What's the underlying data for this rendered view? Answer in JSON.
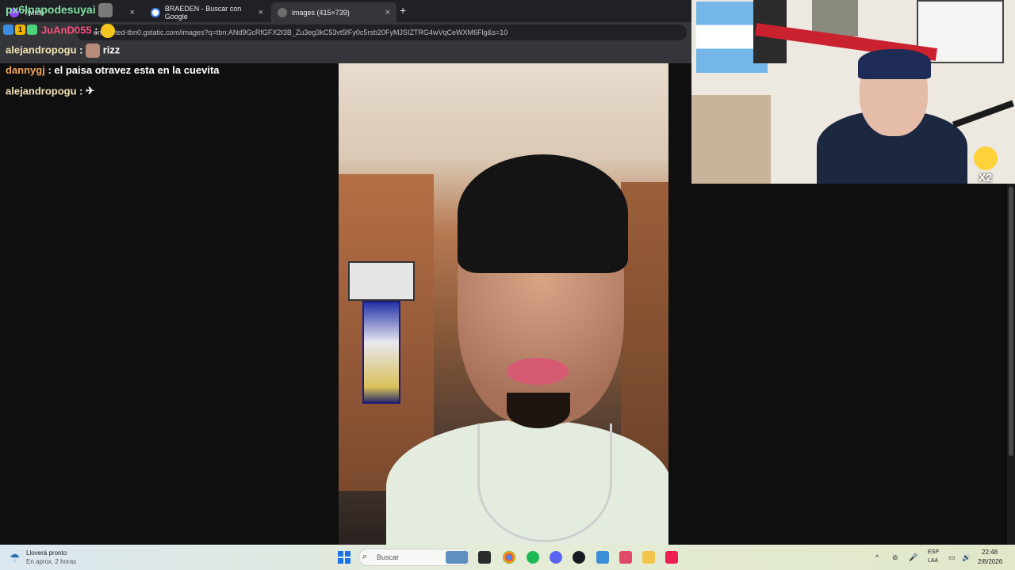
{
  "browser": {
    "tabs": [
      {
        "title": "Twitch",
        "active": false
      },
      {
        "title": "BRAEDEN - Buscar con Google",
        "active": false
      },
      {
        "title": "images (415×739)",
        "active": true
      }
    ],
    "url": "encrypted-tbn0.gstatic.com/images?q=tbn:ANd9GcRfGFX2I3B_Zu3eg3kC53vt5fFy0c5rsb20FyMJSIZTRG4wVqCeWXM6Flg&s=10",
    "close_glyph": "×",
    "new_tab_glyph": "+"
  },
  "chat": {
    "messages": [
      {
        "user": "px6lpapodesuyai",
        "message": ""
      },
      {
        "user": "JuAnD055",
        "message": ""
      },
      {
        "user": "alejandropogu",
        "message": "rizz"
      },
      {
        "user": "dannygj",
        "message": "el paisa otravez esta en la cuevita"
      },
      {
        "user": "alejandropogu",
        "message": ""
      }
    ],
    "separator": " : ",
    "badge_number": "1"
  },
  "webcam": {
    "multiplier": "X2"
  },
  "taskbar": {
    "weather_title": "Lloverá pronto",
    "weather_sub": "En aprox. 2 horas",
    "search_placeholder": "Buscar",
    "language": "ESP",
    "language_sub": "LAA",
    "time": "22:48",
    "date": "2/8/2026",
    "icons": [
      "weather-icon",
      "windows-start-icon",
      "search-icon",
      "widgets-icon",
      "task-view-icon",
      "chrome-icon",
      "spotify-icon",
      "discord-icon",
      "steam-icon",
      "notepad-icon",
      "snipping-tool-icon",
      "file-explorer-icon",
      "tiktok-icon"
    ]
  },
  "colors": {
    "accent_chat_pink": "#ff4f7b",
    "accent_chat_orange": "#f2a55a",
    "accent_chat_green": "#7fe0a3"
  }
}
